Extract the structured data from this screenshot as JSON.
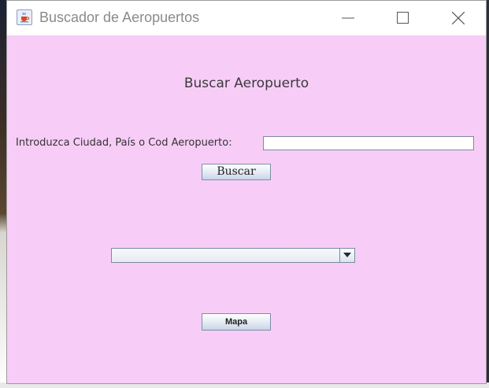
{
  "window": {
    "title": "Buscador de Aeropuertos",
    "app_icon": "java-cup-icon",
    "controls": [
      "minimize-icon",
      "maximize-icon",
      "close-icon"
    ]
  },
  "main": {
    "heading": "Buscar Aeropuerto",
    "search_label": "Introduzca Ciudad, País o Cod Aeropuerto:",
    "search_value": "",
    "search_button": "Buscar",
    "results_selected": "",
    "map_button": "Mapa"
  },
  "colors": {
    "panel_background": "#f7cdf8",
    "titlebar": "#ffffff"
  }
}
